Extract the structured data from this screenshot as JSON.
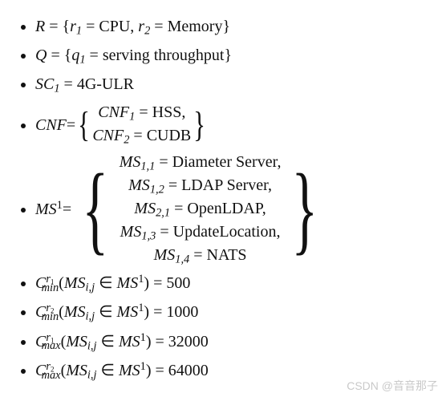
{
  "items": {
    "r": {
      "lhs": "R",
      "eq": " = ",
      "open": "{",
      "r1": "r",
      "r1sub": "1",
      "r1eq": " = CPU, ",
      "r2": "r",
      "r2sub": "2",
      "r2eq": " = Memory",
      "close": "}"
    },
    "q": {
      "lhs": "Q",
      "eq": " = ",
      "open": "{",
      "q1": "q",
      "q1sub": "1",
      "q1eq": " = serving throughput",
      "close": "}"
    },
    "sc": {
      "lhs": "SC",
      "lhssub": "1",
      "eq": " = 4G-ULR"
    },
    "cnf": {
      "lhs": "CNF",
      "eq": " = ",
      "l1a": "CNF",
      "l1sub": "1",
      "l1b": " = HSS,",
      "l2a": "CNF",
      "l2sub": "2",
      "l2b": " = CUDB"
    },
    "ms": {
      "lhs": "MS",
      "lhssup": "1",
      "eq": " = ",
      "l1a": "MS",
      "l1sub": "1,1",
      "l1b": " = Diameter Server,",
      "l2a": "MS",
      "l2sub": "1,2",
      "l2b": " = LDAP Server,",
      "l3a": "MS",
      "l3sub": "2,1",
      "l3b": " = OpenLDAP,",
      "l4a": "MS",
      "l4sub": "1,3",
      "l4b": " = UpdateLocation,",
      "l5a": "MS",
      "l5sub": "1,4",
      "l5b": " = NATS"
    },
    "c1": {
      "C": "C",
      "sup": "r",
      "supn": "1",
      "sub": "min",
      "open": "(",
      "m": "MS",
      "ms": "i,j",
      "in": " ∈ ",
      "M2": "MS",
      "M2s": "1",
      "close": ")",
      "eq": " = 500"
    },
    "c2": {
      "C": "C",
      "sup": "r",
      "supn": "2",
      "sub": "min",
      "open": "(",
      "m": "MS",
      "ms": "i,j",
      "in": " ∈ ",
      "M2": "MS",
      "M2s": "1",
      "close": ")",
      "eq": " = 1000"
    },
    "c3": {
      "C": "C",
      "sup": "r",
      "supn": "1",
      "sub": "max",
      "open": "(",
      "m": "MS",
      "ms": "i,j",
      "in": " ∈ ",
      "M2": "MS",
      "M2s": "1",
      "close": ")",
      "eq": " = 32000"
    },
    "c4": {
      "C": "C",
      "sup": "r",
      "supn": "2",
      "sub": "max",
      "open": "(",
      "m": "MS",
      "ms": "i,j",
      "in": " ∈ ",
      "M2": "MS",
      "M2s": "1",
      "close": ")",
      "eq": " = 64000"
    }
  },
  "watermark": "CSDN @音音那子"
}
